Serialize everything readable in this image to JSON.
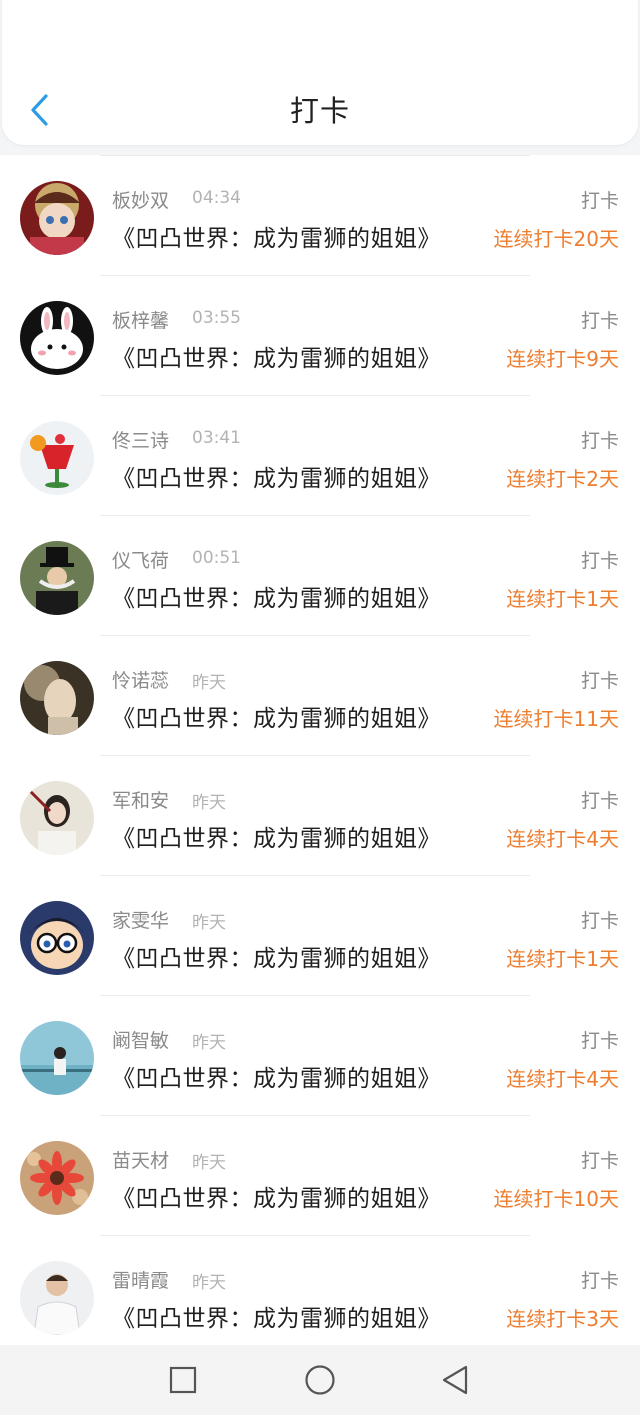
{
  "header": {
    "title": "打卡"
  },
  "checkins": [
    {
      "name": "板妙双",
      "time": "04:34",
      "book": "《凹凸世界：成为雷狮的姐姐》",
      "action": "打卡",
      "streak": "连续打卡20天",
      "avatar": "anime-girl-avatar"
    },
    {
      "name": "板梓馨",
      "time": "03:55",
      "book": "《凹凸世界：成为雷狮的姐姐》",
      "action": "打卡",
      "streak": "连续打卡9天",
      "avatar": "bunny-avatar"
    },
    {
      "name": "佟三诗",
      "time": "03:41",
      "book": "《凹凸世界：成为雷狮的姐姐》",
      "action": "打卡",
      "streak": "连续打卡2天",
      "avatar": "drink-avatar"
    },
    {
      "name": "仪飞荷",
      "time": "00:51",
      "book": "《凹凸世界：成为雷狮的姐姐》",
      "action": "打卡",
      "streak": "连续打卡1天",
      "avatar": "top-hat-man-avatar"
    },
    {
      "name": "怜诺蕊",
      "time": "昨天",
      "book": "《凹凸世界：成为雷狮的姐姐》",
      "action": "打卡",
      "streak": "连续打卡11天",
      "avatar": "blurred-girl-avatar"
    },
    {
      "name": "军和安",
      "time": "昨天",
      "book": "《凹凸世界：成为雷狮的姐姐》",
      "action": "打卡",
      "streak": "连续打卡4天",
      "avatar": "woman-portrait-avatar"
    },
    {
      "name": "家雯华",
      "time": "昨天",
      "book": "《凹凸世界：成为雷狮的姐姐》",
      "action": "打卡",
      "streak": "连续打卡1天",
      "avatar": "cartoon-boy-glasses-avatar"
    },
    {
      "name": "阚智敏",
      "time": "昨天",
      "book": "《凹凸世界：成为雷狮的姐姐》",
      "action": "打卡",
      "streak": "连续打卡4天",
      "avatar": "seaside-girl-avatar"
    },
    {
      "name": "苗天材",
      "time": "昨天",
      "book": "《凹凸世界：成为雷狮的姐姐》",
      "action": "打卡",
      "streak": "连续打卡10天",
      "avatar": "flower-avatar"
    },
    {
      "name": "雷晴霞",
      "time": "昨天",
      "book": "《凹凸世界：成为雷狮的姐姐》",
      "action": "打卡",
      "streak": "连续打卡3天",
      "avatar": "man-white-shirt-avatar"
    }
  ],
  "colors": {
    "accent": "#2f9be4",
    "streak": "#ee7d2f",
    "muted": "#8a8a8a"
  },
  "icons": {
    "back": "chevron-left-icon",
    "nav_recents": "square-icon",
    "nav_home": "circle-icon",
    "nav_back": "triangle-back-icon"
  }
}
